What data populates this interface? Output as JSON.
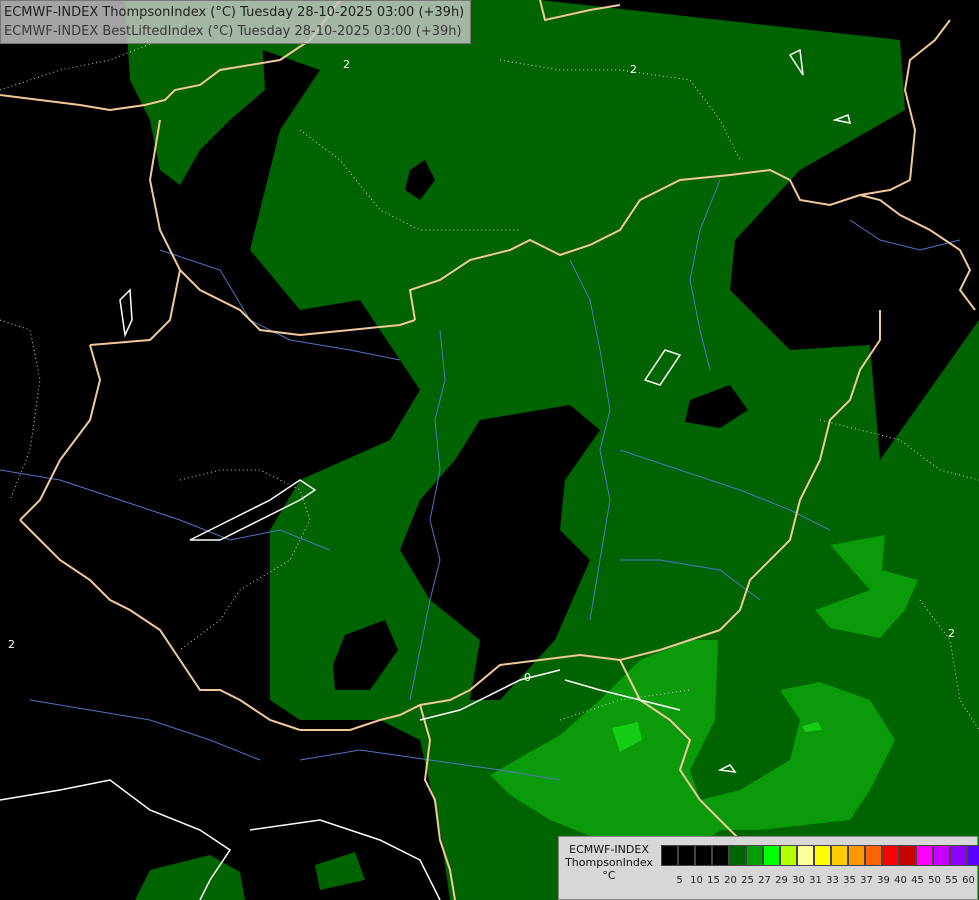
{
  "header": {
    "line1": "ECMWF-INDEX ThompsonIndex (°C) Tuesday 28-10-2025 03:00 (+39h)",
    "line2": "ECMWF-INDEX BestLiftedIndex (°C) Tuesday 28-10-2025 03:00 (+39h)"
  },
  "map": {
    "contour_labels": [
      "2",
      "2",
      "2",
      "2",
      "0"
    ],
    "colors": {
      "background": "#000000",
      "dark_green": "#006400",
      "mid_green": "#0a9a0a",
      "bright_green": "#16cc16",
      "border": "#f0c99a",
      "river": "#4f76c8",
      "contour": "#ffffff"
    }
  },
  "legend": {
    "title_line1": "ECMWF-INDEX",
    "title_line2": "ThompsonIndex",
    "title_line3": "°C",
    "colors": [
      "#000000",
      "#000000",
      "#000000",
      "#000000",
      "#006400",
      "#00a000",
      "#00ff00",
      "#b4ff00",
      "#ffff9c",
      "#ffff00",
      "#ffcc00",
      "#ff9800",
      "#ff6400",
      "#ff0000",
      "#c80000",
      "#ff00ff",
      "#c800ff",
      "#8c00ff",
      "#5a00ff",
      "#0000ff"
    ],
    "ticks": [
      "5",
      "10",
      "15",
      "20",
      "25",
      "27",
      "29",
      "30",
      "31",
      "33",
      "35",
      "37",
      "39",
      "40",
      "45",
      "50",
      "55",
      "60"
    ]
  }
}
